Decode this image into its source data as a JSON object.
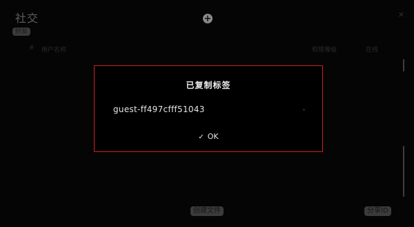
{
  "background": {
    "title": "社交",
    "tab_pill": "好友",
    "add_icon": "plus-circle-icon",
    "close_icon": "close-icon",
    "columns": [
      "#",
      "用户名称",
      "权限等级",
      "在线"
    ],
    "buttons": {
      "files": "创建文件",
      "share": "分享ID"
    }
  },
  "dialog": {
    "title": "已复制标签",
    "value": "guest-ff497cfff51043",
    "ok_label": "OK",
    "ok_icon": "checkmark-icon",
    "border_color": "#d11f1f"
  }
}
